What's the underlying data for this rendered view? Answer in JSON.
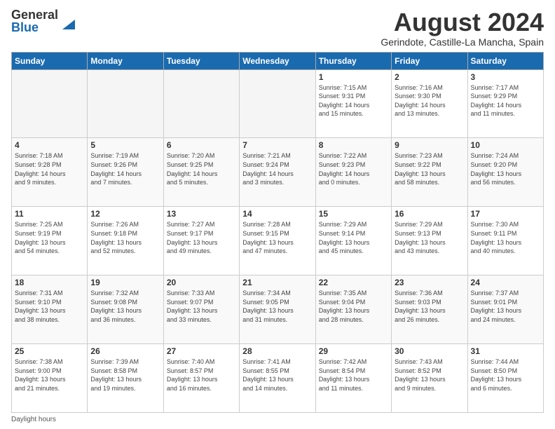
{
  "logo": {
    "general": "General",
    "blue": "Blue"
  },
  "title": {
    "month_year": "August 2024",
    "location": "Gerindote, Castille-La Mancha, Spain"
  },
  "headers": [
    "Sunday",
    "Monday",
    "Tuesday",
    "Wednesday",
    "Thursday",
    "Friday",
    "Saturday"
  ],
  "weeks": [
    [
      {
        "day": "",
        "info": ""
      },
      {
        "day": "",
        "info": ""
      },
      {
        "day": "",
        "info": ""
      },
      {
        "day": "",
        "info": ""
      },
      {
        "day": "1",
        "info": "Sunrise: 7:15 AM\nSunset: 9:31 PM\nDaylight: 14 hours\nand 15 minutes."
      },
      {
        "day": "2",
        "info": "Sunrise: 7:16 AM\nSunset: 9:30 PM\nDaylight: 14 hours\nand 13 minutes."
      },
      {
        "day": "3",
        "info": "Sunrise: 7:17 AM\nSunset: 9:29 PM\nDaylight: 14 hours\nand 11 minutes."
      }
    ],
    [
      {
        "day": "4",
        "info": "Sunrise: 7:18 AM\nSunset: 9:28 PM\nDaylight: 14 hours\nand 9 minutes."
      },
      {
        "day": "5",
        "info": "Sunrise: 7:19 AM\nSunset: 9:26 PM\nDaylight: 14 hours\nand 7 minutes."
      },
      {
        "day": "6",
        "info": "Sunrise: 7:20 AM\nSunset: 9:25 PM\nDaylight: 14 hours\nand 5 minutes."
      },
      {
        "day": "7",
        "info": "Sunrise: 7:21 AM\nSunset: 9:24 PM\nDaylight: 14 hours\nand 3 minutes."
      },
      {
        "day": "8",
        "info": "Sunrise: 7:22 AM\nSunset: 9:23 PM\nDaylight: 14 hours\nand 0 minutes."
      },
      {
        "day": "9",
        "info": "Sunrise: 7:23 AM\nSunset: 9:22 PM\nDaylight: 13 hours\nand 58 minutes."
      },
      {
        "day": "10",
        "info": "Sunrise: 7:24 AM\nSunset: 9:20 PM\nDaylight: 13 hours\nand 56 minutes."
      }
    ],
    [
      {
        "day": "11",
        "info": "Sunrise: 7:25 AM\nSunset: 9:19 PM\nDaylight: 13 hours\nand 54 minutes."
      },
      {
        "day": "12",
        "info": "Sunrise: 7:26 AM\nSunset: 9:18 PM\nDaylight: 13 hours\nand 52 minutes."
      },
      {
        "day": "13",
        "info": "Sunrise: 7:27 AM\nSunset: 9:17 PM\nDaylight: 13 hours\nand 49 minutes."
      },
      {
        "day": "14",
        "info": "Sunrise: 7:28 AM\nSunset: 9:15 PM\nDaylight: 13 hours\nand 47 minutes."
      },
      {
        "day": "15",
        "info": "Sunrise: 7:29 AM\nSunset: 9:14 PM\nDaylight: 13 hours\nand 45 minutes."
      },
      {
        "day": "16",
        "info": "Sunrise: 7:29 AM\nSunset: 9:13 PM\nDaylight: 13 hours\nand 43 minutes."
      },
      {
        "day": "17",
        "info": "Sunrise: 7:30 AM\nSunset: 9:11 PM\nDaylight: 13 hours\nand 40 minutes."
      }
    ],
    [
      {
        "day": "18",
        "info": "Sunrise: 7:31 AM\nSunset: 9:10 PM\nDaylight: 13 hours\nand 38 minutes."
      },
      {
        "day": "19",
        "info": "Sunrise: 7:32 AM\nSunset: 9:08 PM\nDaylight: 13 hours\nand 36 minutes."
      },
      {
        "day": "20",
        "info": "Sunrise: 7:33 AM\nSunset: 9:07 PM\nDaylight: 13 hours\nand 33 minutes."
      },
      {
        "day": "21",
        "info": "Sunrise: 7:34 AM\nSunset: 9:05 PM\nDaylight: 13 hours\nand 31 minutes."
      },
      {
        "day": "22",
        "info": "Sunrise: 7:35 AM\nSunset: 9:04 PM\nDaylight: 13 hours\nand 28 minutes."
      },
      {
        "day": "23",
        "info": "Sunrise: 7:36 AM\nSunset: 9:03 PM\nDaylight: 13 hours\nand 26 minutes."
      },
      {
        "day": "24",
        "info": "Sunrise: 7:37 AM\nSunset: 9:01 PM\nDaylight: 13 hours\nand 24 minutes."
      }
    ],
    [
      {
        "day": "25",
        "info": "Sunrise: 7:38 AM\nSunset: 9:00 PM\nDaylight: 13 hours\nand 21 minutes."
      },
      {
        "day": "26",
        "info": "Sunrise: 7:39 AM\nSunset: 8:58 PM\nDaylight: 13 hours\nand 19 minutes."
      },
      {
        "day": "27",
        "info": "Sunrise: 7:40 AM\nSunset: 8:57 PM\nDaylight: 13 hours\nand 16 minutes."
      },
      {
        "day": "28",
        "info": "Sunrise: 7:41 AM\nSunset: 8:55 PM\nDaylight: 13 hours\nand 14 minutes."
      },
      {
        "day": "29",
        "info": "Sunrise: 7:42 AM\nSunset: 8:54 PM\nDaylight: 13 hours\nand 11 minutes."
      },
      {
        "day": "30",
        "info": "Sunrise: 7:43 AM\nSunset: 8:52 PM\nDaylight: 13 hours\nand 9 minutes."
      },
      {
        "day": "31",
        "info": "Sunrise: 7:44 AM\nSunset: 8:50 PM\nDaylight: 13 hours\nand 6 minutes."
      }
    ]
  ],
  "footer": "Daylight hours"
}
